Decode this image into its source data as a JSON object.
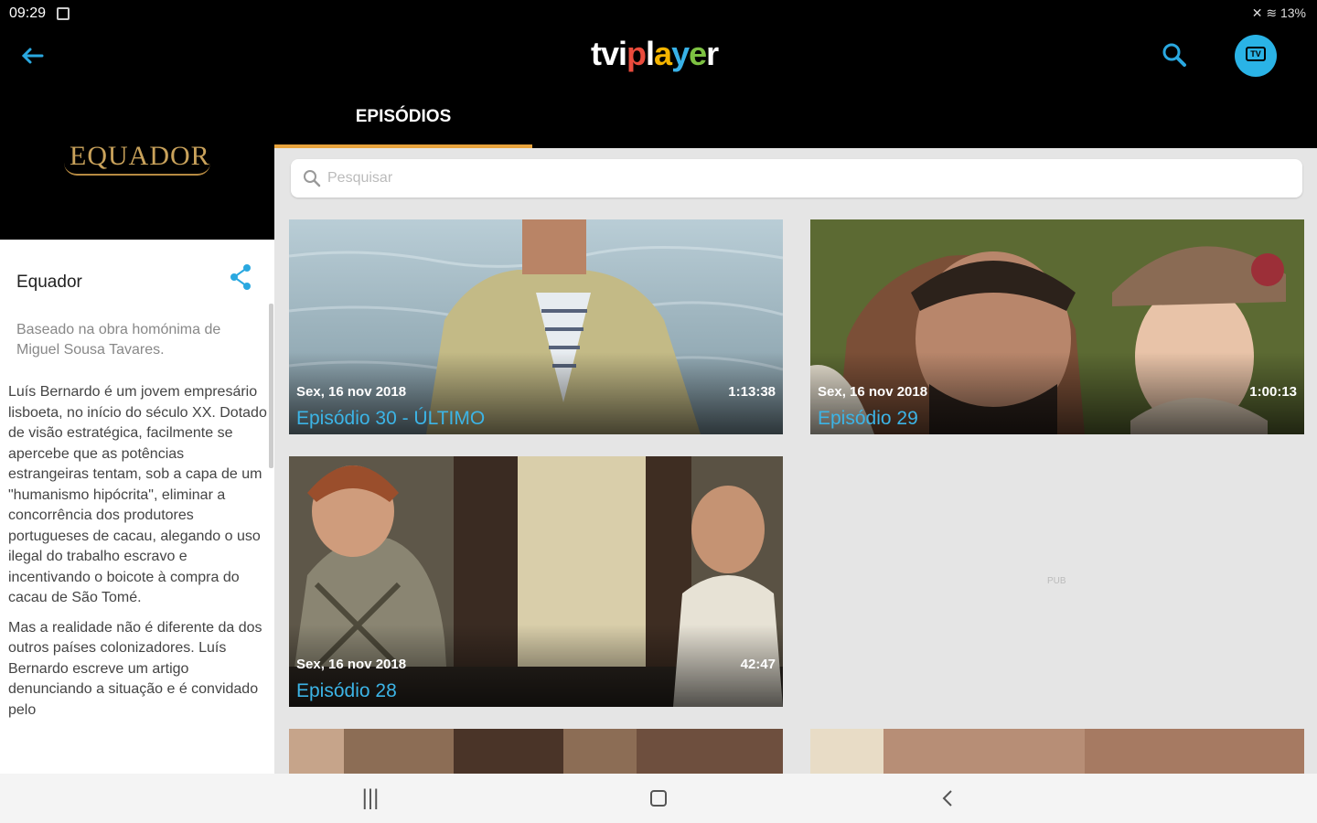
{
  "status": {
    "time": "09:29",
    "battery": "13%"
  },
  "app": {
    "logo": [
      "tvi",
      "p",
      "l",
      "a",
      "y",
      "e",
      "r"
    ],
    "back_icon": "arrow-left-icon",
    "search_icon": "search-icon",
    "tv_label": "TV"
  },
  "show": {
    "logo_text": "EQUADOR",
    "title": "Equador",
    "subtitle": "Baseado na obra homónima de Miguel Sousa Tavares.",
    "description": [
      "Luís Bernardo é um jovem empresário lisboeta, no início do século XX. Dotado de visão estratégica, facilmente se apercebe que as potências estrangeiras tentam, sob a capa de um \"humanismo hipócrita\", eliminar a concorrência dos produtores portugueses de cacau, alegando o uso ilegal do trabalho escravo e incentivando o boicote à compra do cacau de São Tomé.",
      "Mas a realidade não é diferente da dos outros países colonizadores. Luís Bernardo escreve um artigo denunciando a situação e é convidado pelo"
    ]
  },
  "tabs": [
    {
      "label": "EPISÓDIOS",
      "active": true
    }
  ],
  "search": {
    "placeholder": "Pesquisar",
    "value": ""
  },
  "episodes": [
    {
      "date": "Sex, 16 nov 2018",
      "duration": "1:13:38",
      "title": "Episódio 30 - ÚLTIMO"
    },
    {
      "date": "Sex, 16 nov 2018",
      "duration": "1:00:13",
      "title": "Episódio 29"
    },
    {
      "date": "Sex, 16 nov 2018",
      "duration": "42:47",
      "title": "Episódio 28"
    }
  ],
  "empty_slot_text": "PUB",
  "colors": {
    "accent": "#2ab3e6",
    "tab_indicator": "#e8a33c",
    "episode_title": "#3cb4e6"
  }
}
